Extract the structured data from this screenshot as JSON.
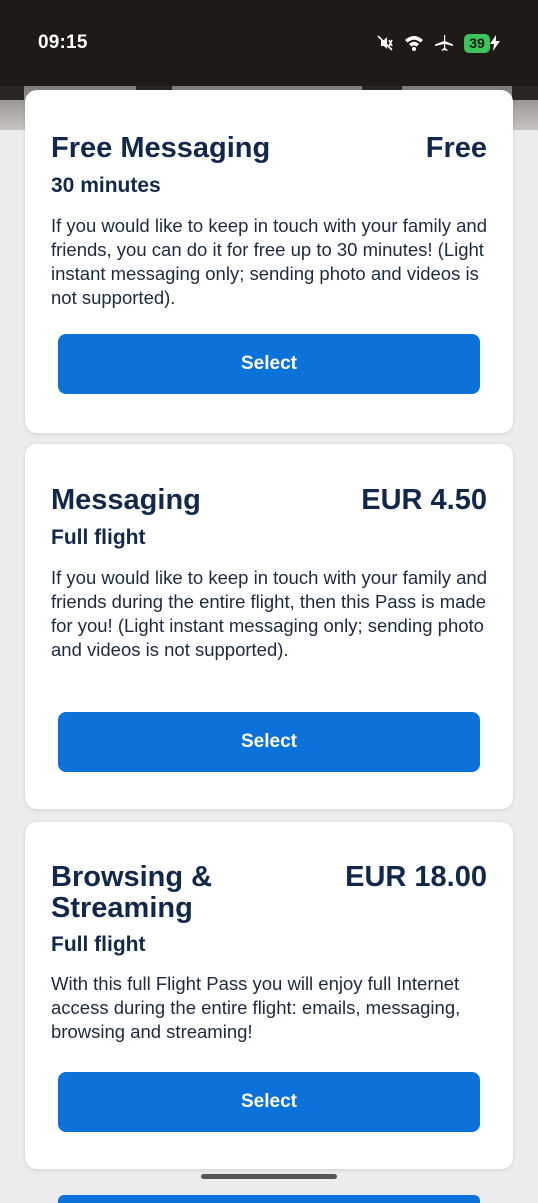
{
  "status_bar": {
    "time": "09:15",
    "battery_level": "39",
    "icons": [
      "mute-vibrate-icon",
      "wifi-icon",
      "airplane-icon",
      "battery-icon",
      "charging-bolt-icon"
    ]
  },
  "passes": [
    {
      "title": "Free Messaging",
      "price": "Free",
      "duration": "30 minutes",
      "description": "If you would like to keep in touch with your family and friends, you can do it for free up to 30 minutes! (Light instant messaging only; sending photo and videos is not supported).",
      "button_label": "Select"
    },
    {
      "title": "Messaging",
      "price": "EUR 4.50",
      "duration": "Full flight",
      "description": "If you would like to keep in touch with your family and friends during the entire flight, then this Pass is made for you! (Light instant messaging only; sending photo and videos is not supported).",
      "button_label": "Select"
    },
    {
      "title": "Browsing & Streaming",
      "price": "EUR 18.00",
      "duration": "Full flight",
      "description": "With this full Flight Pass you will enjoy full Internet access during the entire flight: emails, messaging, browsing and streaming!",
      "button_label": "Select"
    }
  ],
  "colors": {
    "accent": "#0b72d9",
    "title_text": "#12284b",
    "background": "#ececee",
    "status_bar": "#1e1a16"
  }
}
